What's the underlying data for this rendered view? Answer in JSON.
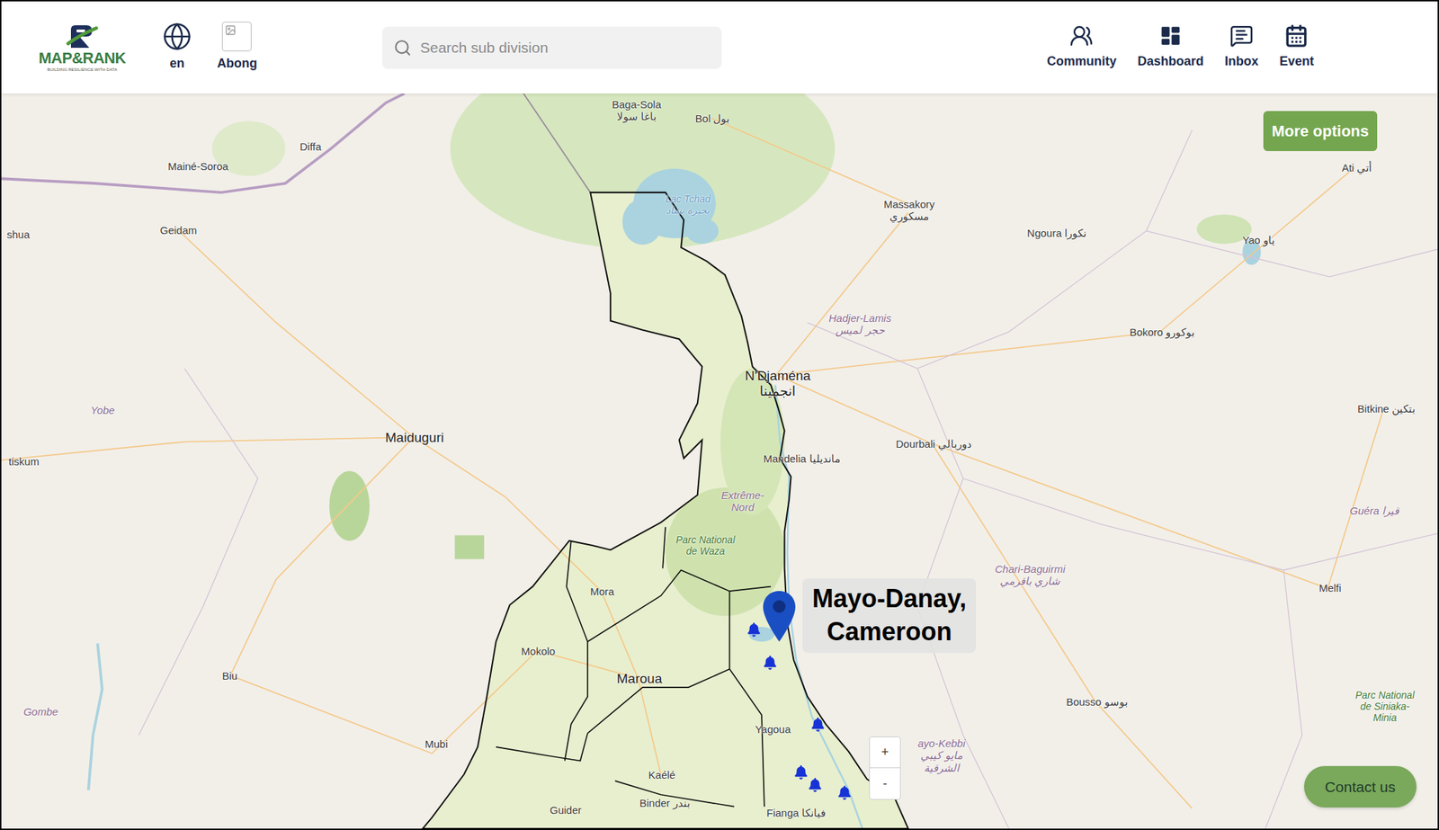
{
  "header": {
    "logo": {
      "name": "MAP&RANK",
      "tagline": "BUILDING RESILIENCE WITH DATA"
    },
    "language": "en",
    "location": "Abong",
    "search": {
      "placeholder": "Search sub division"
    },
    "nav": [
      {
        "label": "Community"
      },
      {
        "label": "Dashboard"
      },
      {
        "label": "Inbox"
      },
      {
        "label": "Event"
      }
    ]
  },
  "map": {
    "labels": [
      {
        "lines": [
          "Baga-Sola",
          "باغا سولا"
        ],
        "kind": "town"
      },
      {
        "lines": [
          "Bol بول"
        ],
        "kind": "town"
      },
      {
        "lines": [
          "Mainé-Soroa"
        ],
        "kind": "town"
      },
      {
        "lines": [
          "Diffa"
        ],
        "kind": "town"
      },
      {
        "lines": [
          "Geidam"
        ],
        "kind": "town"
      },
      {
        "lines": [
          "shua"
        ],
        "kind": "town"
      },
      {
        "lines": [
          "Lac Tchad",
          "بحيرة تشاد"
        ],
        "kind": "water"
      },
      {
        "lines": [
          "Massakory",
          "مسكوري"
        ],
        "kind": "town"
      },
      {
        "lines": [
          "Ngoura نكورا"
        ],
        "kind": "town"
      },
      {
        "lines": [
          "Yao ياو"
        ],
        "kind": "town"
      },
      {
        "lines": [
          "Ati أتي"
        ],
        "kind": "town"
      },
      {
        "lines": [
          "Hadjer-Lamis",
          "حجر لميس"
        ],
        "kind": "region"
      },
      {
        "lines": [
          "N'Djaména",
          "انجمينا"
        ],
        "kind": "city"
      },
      {
        "lines": [
          "Yobe"
        ],
        "kind": "region"
      },
      {
        "lines": [
          "Maiduguri"
        ],
        "kind": "city"
      },
      {
        "lines": [
          "tiskum"
        ],
        "kind": "town"
      },
      {
        "lines": [
          "Mandelia مانديليا"
        ],
        "kind": "town"
      },
      {
        "lines": [
          "Dourbali دوربالي"
        ],
        "kind": "town"
      },
      {
        "lines": [
          "Bokoro بوكورو"
        ],
        "kind": "town"
      },
      {
        "lines": [
          "Bitkine بتكين"
        ],
        "kind": "town"
      },
      {
        "lines": [
          "Extrême-",
          "Nord"
        ],
        "kind": "region"
      },
      {
        "lines": [
          "Parc National",
          "de Waza"
        ],
        "kind": "park"
      },
      {
        "lines": [
          "Chari-Baguirmi",
          "شاري باقرمي"
        ],
        "kind": "region"
      },
      {
        "lines": [
          "Guéra قيرا"
        ],
        "kind": "region"
      },
      {
        "lines": [
          "Melfi"
        ],
        "kind": "town"
      },
      {
        "lines": [
          "Mora"
        ],
        "kind": "town"
      },
      {
        "lines": [
          "Mokolo"
        ],
        "kind": "town"
      },
      {
        "lines": [
          "Maroua"
        ],
        "kind": "city"
      },
      {
        "lines": [
          "Biu"
        ],
        "kind": "town"
      },
      {
        "lines": [
          "Gombe"
        ],
        "kind": "region"
      },
      {
        "lines": [
          "Mubi"
        ],
        "kind": "town"
      },
      {
        "lines": [
          "Kaélé"
        ],
        "kind": "town"
      },
      {
        "lines": [
          "Guider"
        ],
        "kind": "town"
      },
      {
        "lines": [
          "Binder بندر"
        ],
        "kind": "town"
      },
      {
        "lines": [
          "Fianga فيانكا"
        ],
        "kind": "town"
      },
      {
        "lines": [
          "Yagoua"
        ],
        "kind": "town"
      },
      {
        "lines": [
          "Bousso بوسو"
        ],
        "kind": "town"
      },
      {
        "lines": [
          "ayo-Kebbi",
          "مايو كيبي",
          "الشرقية"
        ],
        "kind": "region"
      },
      {
        "lines": [
          "Parc National",
          "de Siniaka-",
          "Minia"
        ],
        "kind": "park"
      }
    ],
    "marker": {
      "lines": [
        "Mayo-Danay,",
        "Cameroon"
      ]
    },
    "zoom": {
      "in": "+",
      "out": "-"
    }
  },
  "buttons": {
    "more": "More options",
    "contact": "Contact us"
  }
}
